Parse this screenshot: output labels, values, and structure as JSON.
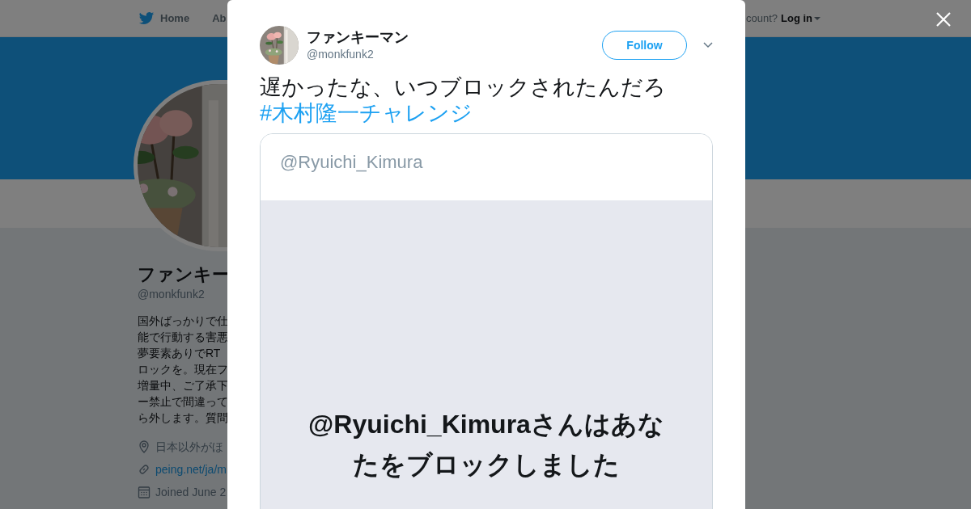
{
  "nav": {
    "items": [
      {
        "label": "Home"
      },
      {
        "label": "Ab"
      }
    ],
    "login_prompt": "count?",
    "login": "Log in"
  },
  "profile": {
    "name": "ファンキー",
    "handle": "@monkfunk2",
    "bio_lines": [
      "国外ばっかりで仕",
      "能で行動する害悪",
      "夢要素ありでRT",
      "ロックを。現在フ",
      "増量中、ご了承下",
      "ー禁止で間違って",
      "ら外します。質問"
    ],
    "location": "日本以外がほ",
    "link": "peing.net/ja/m",
    "joined": "Joined June 2"
  },
  "tweet": {
    "author": "ファンキーマン",
    "handle": "@monkfunk2",
    "follow": "Follow",
    "text": "遅かったな、いつブロックされたんだろ",
    "hashtag": "#木村隆一チャレンジ",
    "image": {
      "handle": "@Ryuichi_Kimura",
      "message": "@Ryuichi_Kimuraさんはあなたをブロックしました"
    }
  }
}
